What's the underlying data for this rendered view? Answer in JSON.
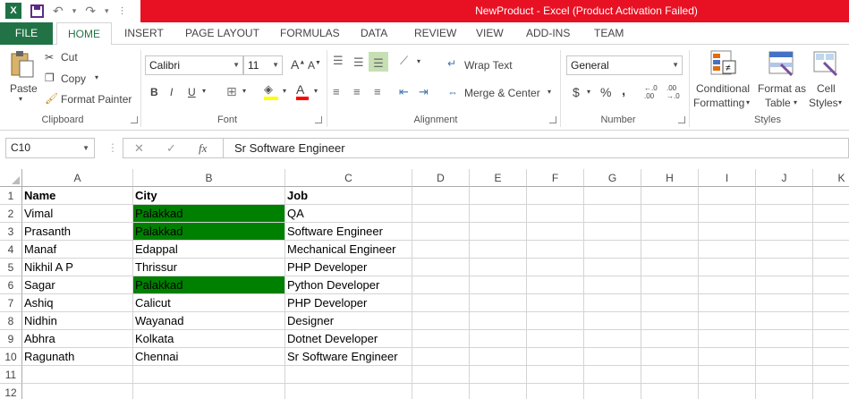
{
  "title": "NewProduct -  Excel (Product Activation Failed)",
  "tabs": [
    "FILE",
    "HOME",
    "INSERT",
    "PAGE LAYOUT",
    "FORMULAS",
    "DATA",
    "REVIEW",
    "VIEW",
    "ADD-INS",
    "TEAM"
  ],
  "clipboard": {
    "paste": "Paste",
    "cut": "Cut",
    "copy": "Copy",
    "format_painter": "Format Painter",
    "label": "Clipboard"
  },
  "font": {
    "name": "Calibri",
    "size": "11",
    "label": "Font",
    "bold": "B",
    "italic": "I",
    "underline": "U"
  },
  "alignment": {
    "wrap": "Wrap Text",
    "merge": "Merge & Center",
    "label": "Alignment"
  },
  "number": {
    "format": "General",
    "label": "Number",
    "currency": "$",
    "percent": "%",
    "comma": ","
  },
  "styles": {
    "conditional_1": "Conditional",
    "conditional_2": "Formatting",
    "format_table_1": "Format as",
    "format_table_2": "Table",
    "cell_styles_1": "Cell",
    "cell_styles_2": "Styles",
    "label": "Styles"
  },
  "formula_bar": {
    "name_box": "C10",
    "fx": "fx",
    "value": "Sr Software Engineer"
  },
  "columns": [
    "A",
    "B",
    "C",
    "D",
    "E",
    "F",
    "G",
    "H",
    "I",
    "J",
    "K"
  ],
  "row_numbers": [
    "1",
    "2",
    "3",
    "4",
    "5",
    "6",
    "7",
    "8",
    "9",
    "10",
    "11",
    "12"
  ],
  "rows": [
    [
      "Name",
      "City",
      "Job"
    ],
    [
      "Vimal",
      "Palakkad",
      "QA"
    ],
    [
      "Prasanth",
      "Palakkad",
      "Software Engineer"
    ],
    [
      "Manaf",
      "Edappal",
      "Mechanical Engineer"
    ],
    [
      "Nikhil A P",
      "Thrissur",
      "PHP Developer"
    ],
    [
      "Sagar",
      "Palakkad",
      "Python Developer"
    ],
    [
      "Ashiq",
      "Calicut",
      "PHP Developer"
    ],
    [
      "Nidhin",
      "Wayanad",
      "Designer"
    ],
    [
      "Abhra",
      "Kolkata",
      "Dotnet Developer"
    ],
    [
      "Ragunath",
      "Chennai",
      "Sr Software Engineer"
    ]
  ],
  "highlight_color": "#008000",
  "accent_color": "#217346",
  "title_bar_color": "#e81123"
}
